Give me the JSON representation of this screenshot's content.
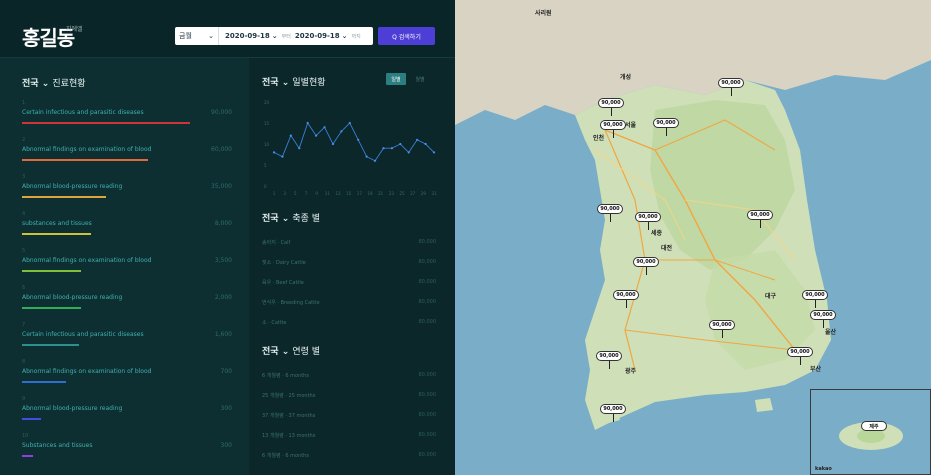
{
  "header": {
    "logo": "홍길동",
    "logo_sub": "지에엘",
    "filter_type": "금월",
    "date_start": "2020-09-18",
    "from_label": "부터",
    "date_end": "2020-09-18",
    "to_label": "까지",
    "search_label": "Q 검색하기"
  },
  "left": {
    "title_region": "전국",
    "title_rest": "진료현황",
    "rows": [
      {
        "num": "1",
        "name": "Certain infectious and parasitic diseases",
        "value": "90,000",
        "color": "#d0343a",
        "frac": 0.8
      },
      {
        "num": "2",
        "name": "Abnormal findings on examination of blood",
        "value": "60,000",
        "color": "#e06a3a",
        "frac": 0.6
      },
      {
        "num": "3",
        "name": "Abnormal blood-pressure reading",
        "value": "35,000",
        "color": "#e0a53a",
        "frac": 0.4
      },
      {
        "num": "4",
        "name": "substances and tissues",
        "value": "8,000",
        "color": "#c9c23a",
        "frac": 0.33
      },
      {
        "num": "5",
        "name": "Abnormal findings on examination of blood",
        "value": "3,500",
        "color": "#7fbf3a",
        "frac": 0.28
      },
      {
        "num": "6",
        "name": "Abnormal blood-pressure reading",
        "value": "2,000",
        "color": "#2fae5a",
        "frac": 0.28
      },
      {
        "num": "7",
        "name": "Certain infectious and parasitic diseases",
        "value": "1,600",
        "color": "#2f8f8f",
        "frac": 0.27
      },
      {
        "num": "8",
        "name": "Abnormal findings on examination of blood",
        "value": "700",
        "color": "#2f6fcf",
        "frac": 0.21
      },
      {
        "num": "9",
        "name": "Abnormal blood-pressure reading",
        "value": "300",
        "color": "#3f4fdf",
        "frac": 0.09
      },
      {
        "num": "10",
        "name": "Substances and tissues",
        "value": "300",
        "color": "#8f3fdf",
        "frac": 0.05
      }
    ]
  },
  "mid": {
    "daily": {
      "region": "전국",
      "title": "일별현황",
      "toggle_on": "일별",
      "toggle_off": "월별"
    },
    "livestock": {
      "region": "전국",
      "title": "축종 별",
      "rows": [
        {
          "label": "송아지 · Calf",
          "value": "80,000"
        },
        {
          "label": "젖소 · Dairy Cattle",
          "value": "80,000"
        },
        {
          "label": "육우 · Beef Cattle",
          "value": "80,000"
        },
        {
          "label": "번식우 · Breeding Cattle",
          "value": "80,000"
        },
        {
          "label": "소 · Cattle",
          "value": "80,000"
        }
      ]
    },
    "age": {
      "region": "전국",
      "title": "연령 별",
      "rows": [
        {
          "label": "6 개월령 · 6 months",
          "value": "80,000"
        },
        {
          "label": "25 개월령 · 25 months",
          "value": "80,000"
        },
        {
          "label": "37 개월령 · 37 months",
          "value": "80,000"
        },
        {
          "label": "13 개월령 · 13 months",
          "value": "80,000"
        },
        {
          "label": "6 개월령 · 6 months",
          "value": "80,000"
        }
      ]
    }
  },
  "chart_data": {
    "type": "line",
    "x": [
      "1",
      "2",
      "3",
      "4",
      "5",
      "6",
      "7",
      "8",
      "9",
      "10",
      "11",
      "12",
      "13",
      "14",
      "15",
      "16",
      "17",
      "18",
      "19",
      "20"
    ],
    "values": [
      8,
      7,
      12,
      9,
      15,
      12,
      14,
      10,
      13,
      15,
      11,
      7,
      6,
      9,
      9,
      10,
      8,
      11,
      10,
      8
    ],
    "y_ticks": [
      "20",
      "15",
      "10",
      "5",
      "0"
    ],
    "x_ticks": [
      "1",
      "3",
      "5",
      "7",
      "9",
      "11",
      "13",
      "15",
      "17",
      "19",
      "21",
      "23",
      "25",
      "27",
      "29",
      "31"
    ],
    "ylim": [
      0,
      20
    ]
  },
  "map": {
    "pin_label": "90,000",
    "cities": [
      "사리원",
      "개성",
      "서울",
      "인천",
      "세종",
      "대전",
      "대구",
      "울산",
      "부산",
      "광주",
      "제주"
    ],
    "kakao": "kakao"
  }
}
